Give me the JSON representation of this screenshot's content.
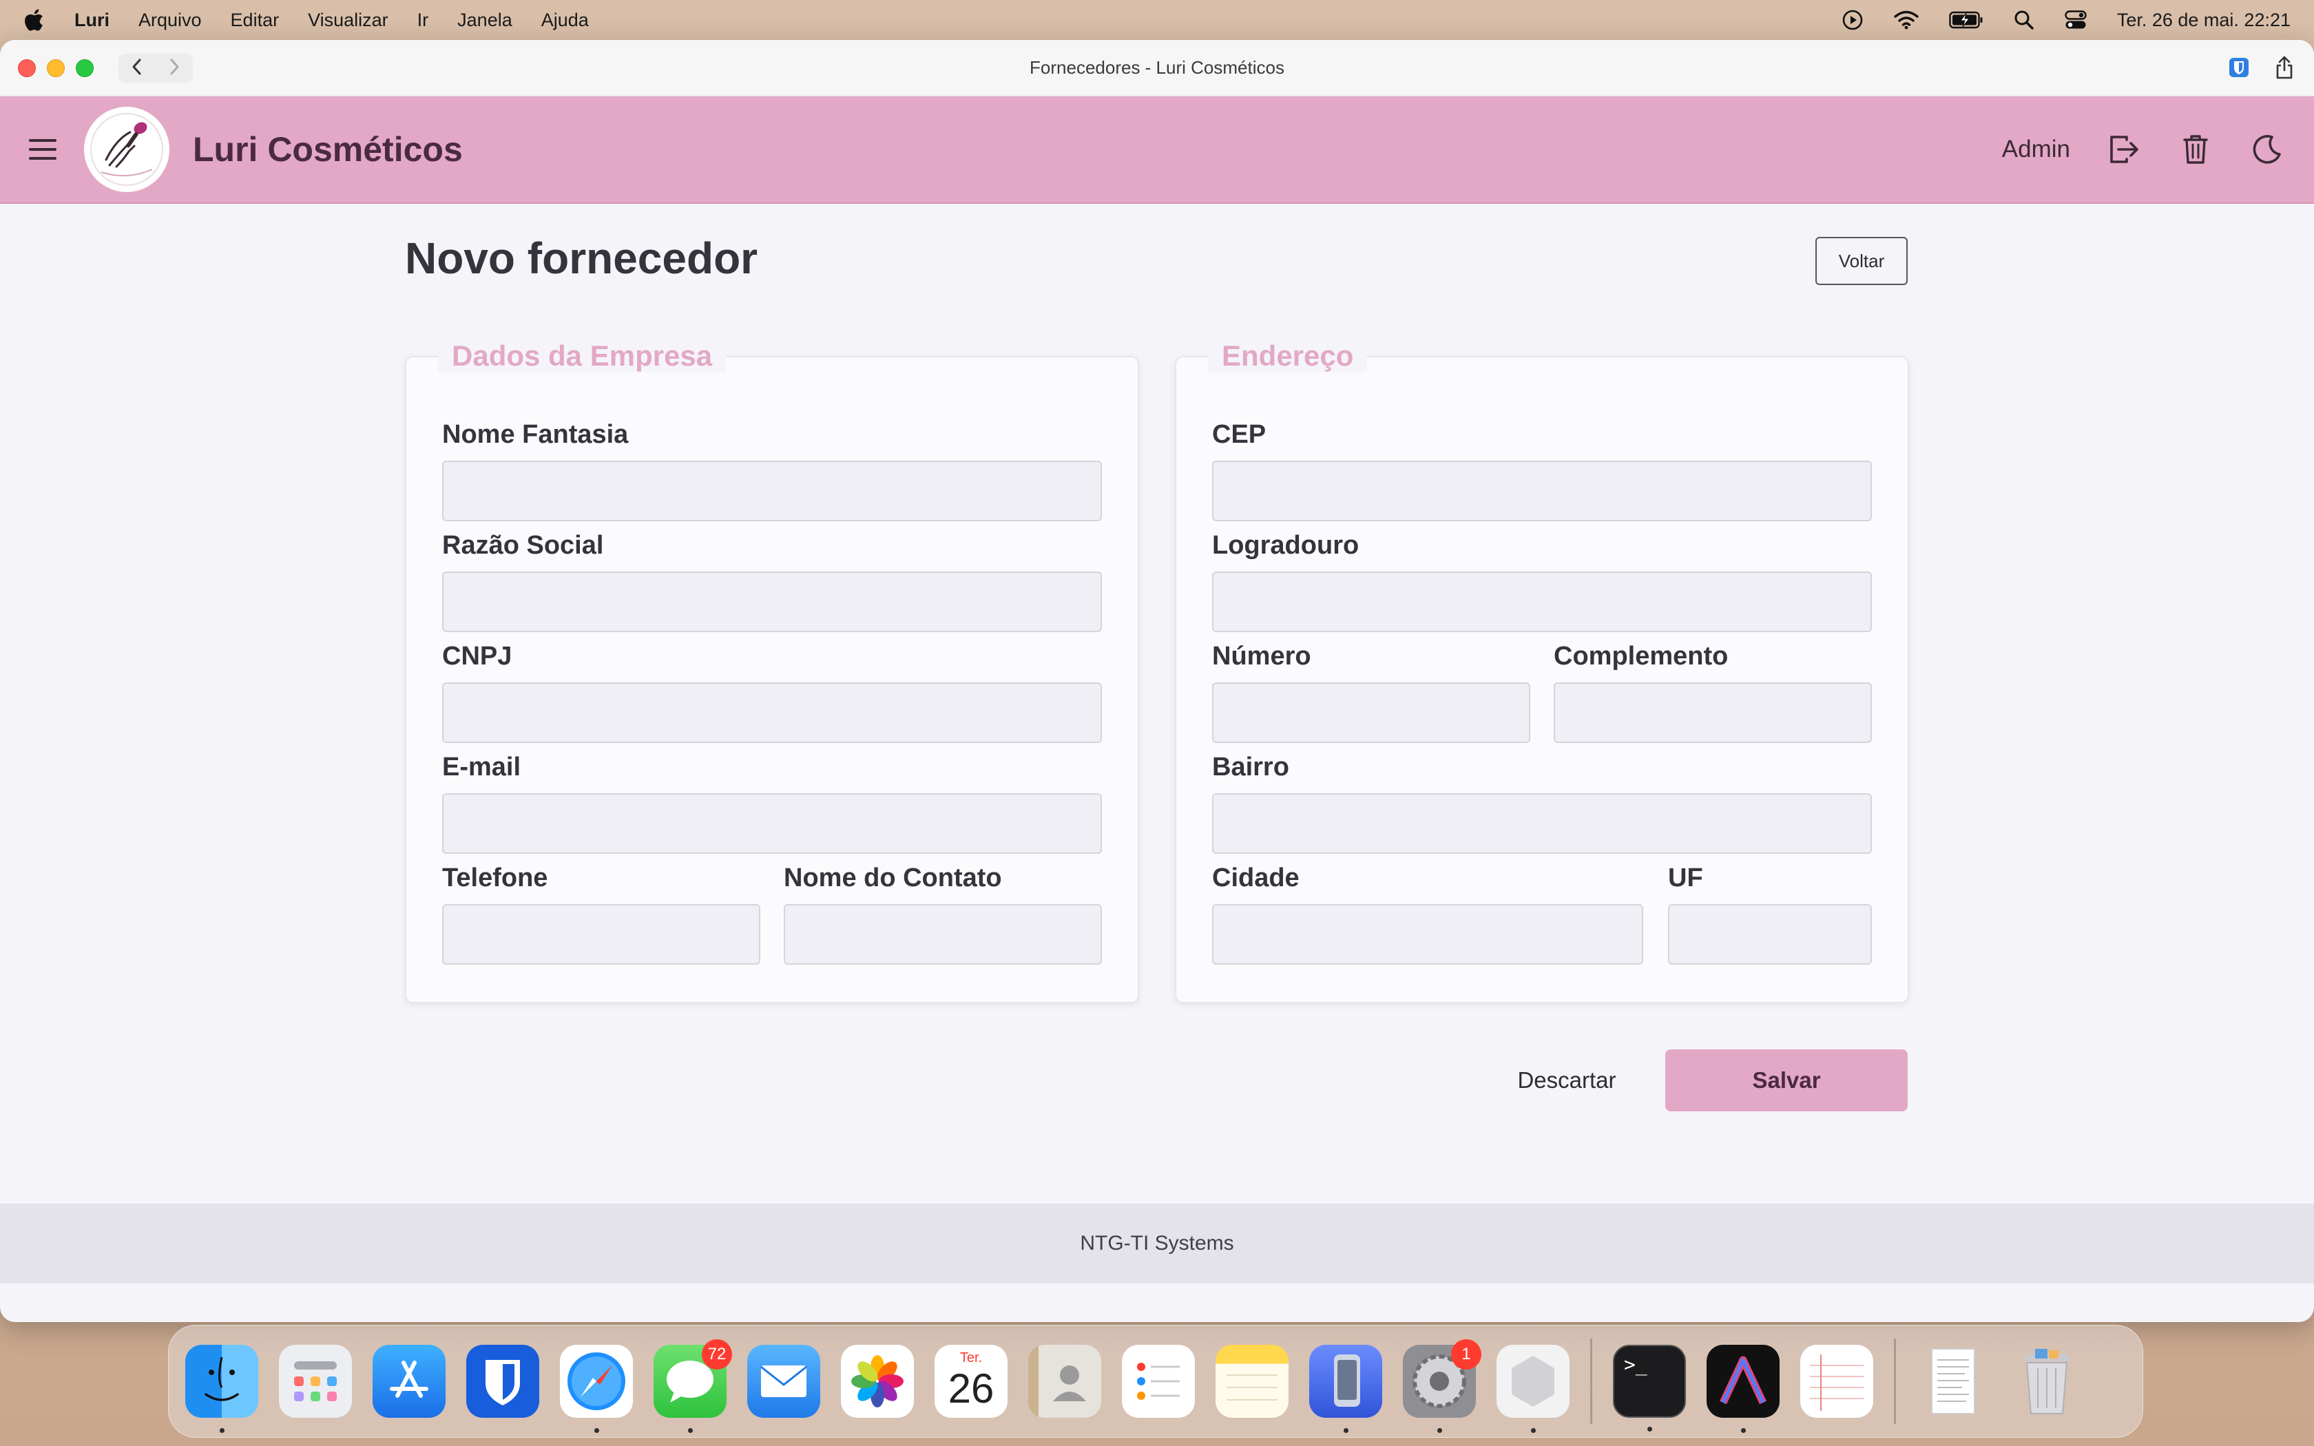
{
  "menubar": {
    "app_name": "Luri",
    "items": [
      "Arquivo",
      "Editar",
      "Visualizar",
      "Ir",
      "Janela",
      "Ajuda"
    ],
    "datetime": "Ter. 26 de mai.  22:21"
  },
  "window": {
    "title": "Fornecedores - Luri Cosméticos"
  },
  "header": {
    "brand": "Luri Cosméticos",
    "user": "Admin"
  },
  "page": {
    "title": "Novo fornecedor",
    "back_label": "Voltar"
  },
  "company": {
    "legend": "Dados da Empresa",
    "fields": {
      "nome_fantasia": "Nome Fantasia",
      "razao_social": "Razão Social",
      "cnpj": "CNPJ",
      "email": "E-mail",
      "telefone": "Telefone",
      "nome_contato": "Nome do Contato"
    }
  },
  "address": {
    "legend": "Endereço",
    "fields": {
      "cep": "CEP",
      "logradouro": "Logradouro",
      "numero": "Número",
      "complemento": "Complemento",
      "bairro": "Bairro",
      "cidade": "Cidade",
      "uf": "UF"
    }
  },
  "actions": {
    "discard": "Descartar",
    "save": "Salvar"
  },
  "footer": {
    "text": "NTG-TI Systems"
  },
  "dock": {
    "messages_badge": "72",
    "calendar_month": "Ter.",
    "calendar_day": "26",
    "settings_badge": "1",
    "terminal_prompt": ">_"
  },
  "colors": {
    "accent": "#e3a8c6",
    "brand_text": "#4a2a3f",
    "page_bg": "#f5f4f8"
  }
}
